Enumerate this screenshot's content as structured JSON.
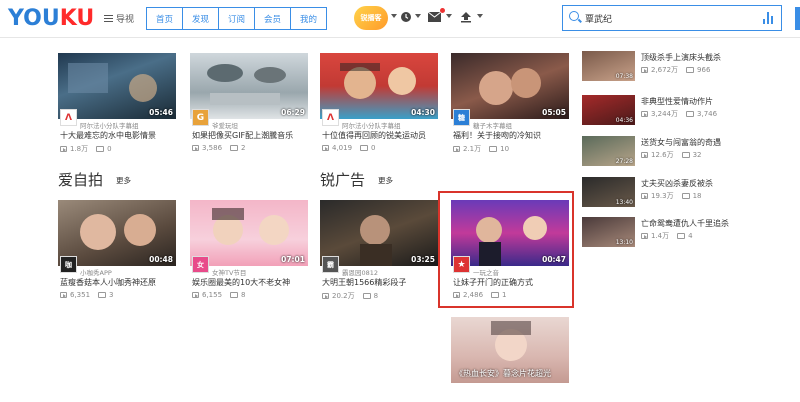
{
  "header": {
    "logo_you": "YOU",
    "logo_ku": "KU",
    "nav_toggle": "导视",
    "tabs": [
      "首页",
      "发现",
      "订阅",
      "会员",
      "我的"
    ],
    "badge_text": "锐播客",
    "search": {
      "value": "覃武纪"
    }
  },
  "feed_row1": [
    {
      "uploader": "阿尔法小分队字幕组",
      "title": "十大最难忘的水中电影情景",
      "views": "1.8万",
      "comments": "0",
      "duration": "05:46",
      "avatar": "Λ"
    },
    {
      "uploader": "爷爱玩坦",
      "title": "如果把像买GIF配上潮騰音乐",
      "views": "3,586",
      "comments": "2",
      "duration": "06:29",
      "avatar": "G"
    },
    {
      "uploader": "阿尔法小分队字幕组",
      "title": "十位值得再回顾的锐美运动员",
      "views": "4,019",
      "comments": "0",
      "duration": "04:30",
      "avatar": "Λ"
    },
    {
      "uploader": "糖子木字幕组",
      "title": "福利！关于接吻的冷知识",
      "views": "2.1万",
      "comments": "10",
      "duration": "05:05",
      "avatar": "糖"
    }
  ],
  "sections": [
    {
      "title": "爱自拍",
      "more": "更多"
    },
    {
      "title": "锐广告",
      "more": "更多"
    }
  ],
  "feed_row2": [
    {
      "uploader": "小咖秀APP",
      "title": "蓝瘦香菇本人小咖秀神还原",
      "views": "6,351",
      "comments": "3",
      "duration": "00:48",
      "avatar": "咖"
    },
    {
      "uploader": "女神TV节目",
      "title": "娱乐圈最美的10大不老女神",
      "views": "6,155",
      "comments": "8",
      "duration": "07:01",
      "avatar": "女"
    },
    {
      "uploader": "霸恩园0812",
      "title": "大明王朝1566精彩段子",
      "views": "20.2万",
      "comments": "8",
      "duration": "03:25",
      "avatar": "霸"
    },
    {
      "uploader": "一玩之音",
      "title": "让妹子开门的正确方式",
      "views": "2,486",
      "comments": "1",
      "duration": "00:47",
      "avatar": "★"
    }
  ],
  "sidebar": [
    {
      "title": "顶级杀手上演床头截杀",
      "views": "2,672万",
      "comments": "966",
      "duration": "07:38"
    },
    {
      "title": "非典型性爱情动作片",
      "views": "3,244万",
      "comments": "3,746",
      "duration": "04:36"
    },
    {
      "title": "送货女与闯富翁的奇遇",
      "views": "12.6万",
      "comments": "32",
      "duration": "27:28"
    },
    {
      "title": "丈夫买凶杀妻反被杀",
      "views": "19.3万",
      "comments": "18",
      "duration": "13:40"
    },
    {
      "title": "亡命鸳鸯遭仇人千里追杀",
      "views": "1.4万",
      "comments": "4",
      "duration": "13:10"
    }
  ],
  "bottom_card": {
    "caption": "《热血长安》暮念片花超光"
  },
  "colors": {
    "accent": "#3a8ee6",
    "logo_red": "#ff2a2a",
    "highlight": "#d9342b"
  }
}
